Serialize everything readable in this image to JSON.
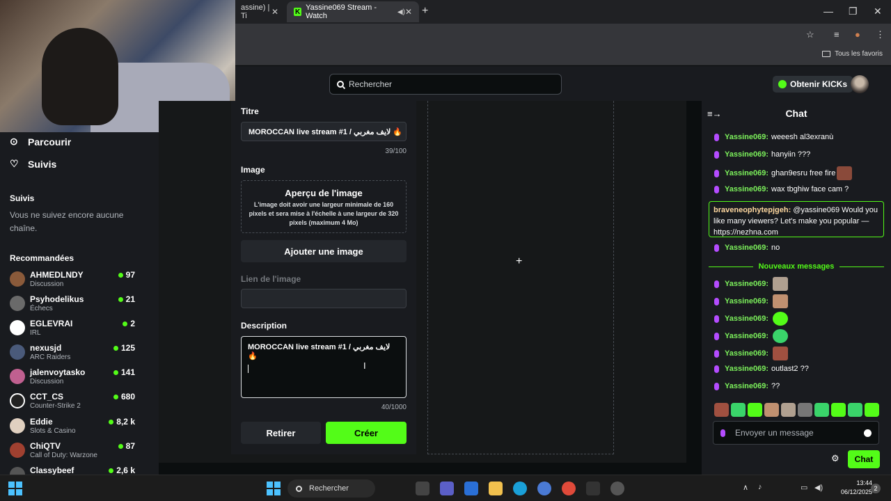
{
  "browser": {
    "tabs": [
      {
        "label": "assine) | Ti",
        "active": false
      },
      {
        "label": "Yassine069 Stream - Watch",
        "active": true
      }
    ],
    "bookmark_label": "Tous les favoris"
  },
  "topnav": {
    "search_placeholder": "Rechercher",
    "kicks_label": "Obtenir KICKs"
  },
  "sidebar": {
    "nav": [
      {
        "label": "Parcourir",
        "icon": "compass-icon"
      },
      {
        "label": "Suivis",
        "icon": "heart-icon"
      }
    ],
    "followed_title": "Suivis",
    "followed_empty": "Vous ne suivez encore aucune chaîne.",
    "recommended_title": "Recommandées",
    "recommended": [
      {
        "name": "AHMEDLNDY",
        "category": "Discussion",
        "viewers": "97",
        "color": "#8a5a3a"
      },
      {
        "name": "Psyhodelikus",
        "category": "Échecs",
        "viewers": "21",
        "color": "#6a6a6a"
      },
      {
        "name": "EGLEVRAI",
        "category": "IRL",
        "viewers": "2",
        "color": "#ffffff"
      },
      {
        "name": "nexusjd",
        "category": "ARC Raiders",
        "viewers": "125",
        "color": "#4a5a7a"
      },
      {
        "name": "jalenvoytasko",
        "category": "Discussion",
        "viewers": "141",
        "color": "#c06090"
      },
      {
        "name": "CCT_CS",
        "category": "Counter-Strike 2",
        "viewers": "680",
        "color": "#222222"
      },
      {
        "name": "Eddie",
        "category": "Slots & Casino",
        "viewers": "8,2 k",
        "color": "#e0d0c0"
      },
      {
        "name": "ChiQTV",
        "category": "Call of Duty: Warzone",
        "viewers": "87",
        "color": "#a04030"
      },
      {
        "name": "Classybeef",
        "category": "",
        "viewers": "2,6 k",
        "color": "#555555"
      }
    ]
  },
  "form": {
    "title_label": "Titre",
    "title_value": "MOROCCAN live stream #1 / لايف مغربي 🔥",
    "title_counter": "39/100",
    "image_label": "Image",
    "preview_title": "Aperçu de l'image",
    "preview_text": "L'image doit avoir une largeur minimale de 160 pixels et sera mise à l'échelle à une largeur de 320 pixels (maximum 4 Mo)",
    "add_image_label": "Ajouter une image",
    "image_link_label": "Lien de l'image",
    "image_link_value": "",
    "description_label": "Description",
    "description_value": "MOROCCAN live stream #1 / لايف مغربي 🔥",
    "description_counter": "40/1000",
    "cancel_label": "Retirer",
    "create_label": "Créer"
  },
  "chat": {
    "title": "Chat",
    "messages": [
      {
        "user": "Yassine069:",
        "text": "weeesh al3exranù",
        "emote": ""
      },
      {
        "user": "Yassine069:",
        "text": "hanyiin ???",
        "emote": ""
      },
      {
        "user": "Yassine069:",
        "text": "ghan9esru free fire",
        "emote": "#8a4a3a"
      },
      {
        "user": "Yassine069:",
        "text": "wax tbghiw face cam ?",
        "emote": ""
      }
    ],
    "highlight": {
      "user": "braveneophytepjgeh:",
      "text": "@yassine069 Would you like many viewers? Let's make you popular — https://nezhna.com"
    },
    "after_highlight": {
      "user": "Yassine069:",
      "text": "no"
    },
    "new_messages_label": "Nouveaux messages",
    "new_messages": [
      {
        "user": "Yassine069:",
        "text": "",
        "emote": "#b0a090"
      },
      {
        "user": "Yassine069:",
        "text": "",
        "emote": "#c09070"
      },
      {
        "user": "Yassine069:",
        "text": "",
        "emote": "#53fc18"
      },
      {
        "user": "Yassine069:",
        "text": "",
        "emote": "#3ad46a"
      },
      {
        "user": "Yassine069:",
        "text": "",
        "emote": "#a05040"
      },
      {
        "user": "Yassine069:",
        "text": "outlast2 ??",
        "emote": ""
      },
      {
        "user": "Yassine069:",
        "text": "??",
        "emote": ""
      }
    ],
    "input_placeholder": "Envoyer un message",
    "send_label": "Chat"
  },
  "taskbar": {
    "search_label": "Rechercher",
    "time": "13:44",
    "date": "06/12/2025",
    "notification_count": "2"
  },
  "colors": {
    "accent": "#53fc18",
    "background": "#0b0e0f",
    "panel": "#191b1f"
  }
}
